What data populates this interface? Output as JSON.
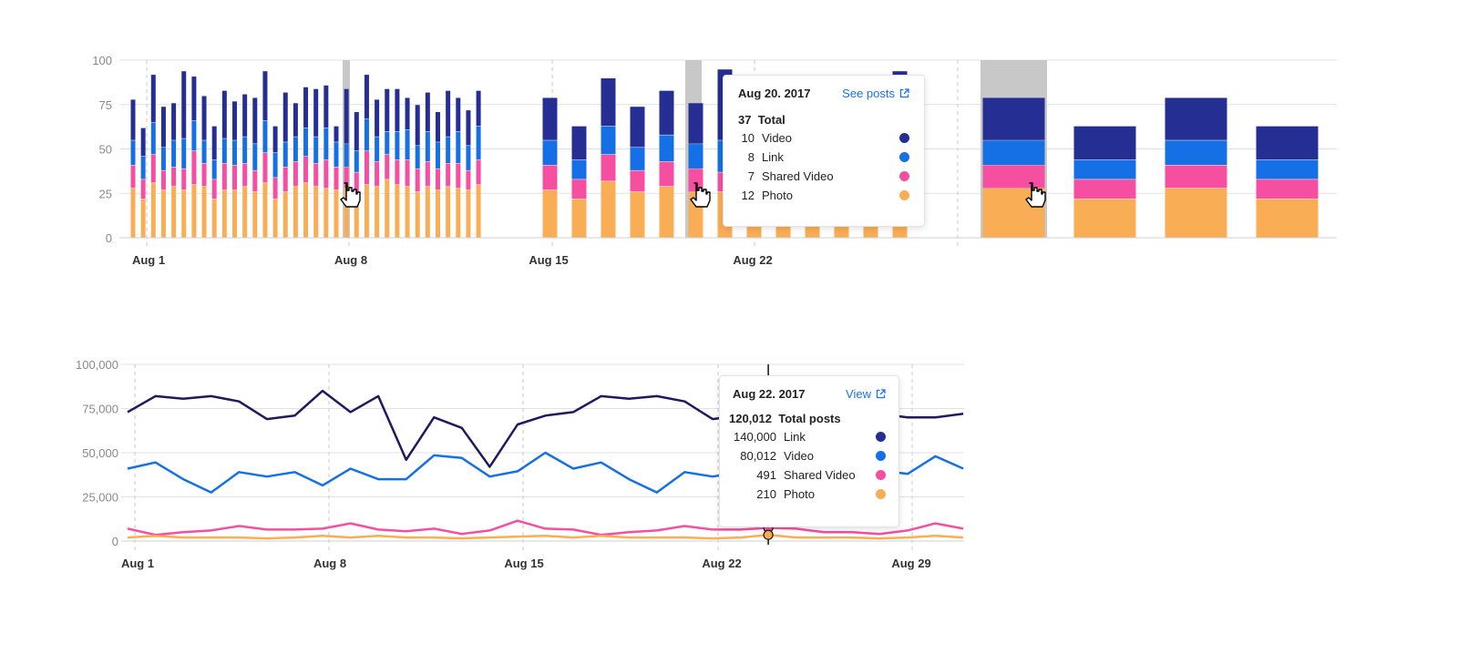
{
  "colors": {
    "video": "#252e92",
    "link": "#1570e6",
    "shared_video": "#f64ea1",
    "photo": "#f9ad55",
    "line_link": "#1e1a5e",
    "line_video": "#1570e6",
    "line_shared": "#f64ea1",
    "line_photo": "#f9ad55",
    "highlight": "#c8c8c8"
  },
  "chart_data": [
    {
      "type": "bar",
      "stacked": true,
      "y_ticks": [
        "100",
        "75",
        "50",
        "25",
        "0"
      ],
      "ylim": [
        0,
        100
      ],
      "x_tick_labels": [
        "Aug 1",
        "Aug 8",
        "Aug 15",
        "Aug 22"
      ],
      "groups": [
        {
          "granularity": "half-day",
          "photo": [
            28,
            22,
            31,
            27,
            29,
            27,
            30,
            29,
            22,
            27,
            27,
            29,
            26,
            31,
            22,
            26,
            29,
            31,
            29,
            28,
            27,
            28,
            26,
            30,
            29,
            33,
            30,
            29,
            26,
            29,
            27,
            29,
            28,
            27,
            30
          ],
          "shared_video": [
            13,
            11,
            16,
            11,
            11,
            12,
            19,
            13,
            11,
            15,
            14,
            13,
            12,
            17,
            12,
            14,
            14,
            15,
            13,
            16,
            13,
            12,
            11,
            19,
            14,
            14,
            14,
            15,
            13,
            14,
            12,
            13,
            14,
            11,
            14
          ],
          "link": [
            14,
            13,
            18,
            13,
            15,
            17,
            17,
            13,
            11,
            14,
            14,
            15,
            15,
            18,
            14,
            14,
            14,
            16,
            15,
            18,
            14,
            13,
            12,
            18,
            14,
            13,
            16,
            17,
            13,
            17,
            15,
            15,
            18,
            14,
            19
          ],
          "video": [
            23,
            16,
            27,
            23,
            21,
            38,
            25,
            25,
            19,
            27,
            22,
            24,
            26,
            28,
            15,
            28,
            19,
            23,
            27,
            24,
            9,
            31,
            22,
            25,
            21,
            24,
            24,
            18,
            23,
            22,
            17,
            26,
            19,
            20,
            20
          ]
        },
        {
          "granularity": "day",
          "photo": [
            27,
            22,
            32,
            26,
            29,
            26,
            26,
            26,
            25,
            26,
            26,
            26,
            26
          ],
          "shared_video": [
            14,
            11,
            15,
            12,
            14,
            13,
            11,
            15,
            12,
            12,
            14,
            14,
            23
          ],
          "link": [
            14,
            11,
            16,
            13,
            15,
            14,
            18,
            17,
            15,
            13,
            18,
            14,
            17
          ],
          "video": [
            24,
            19,
            27,
            23,
            25,
            23,
            40,
            29,
            23,
            23,
            20,
            21,
            28
          ]
        },
        {
          "granularity": "week",
          "photo": [
            28,
            22,
            28,
            22
          ],
          "shared_video": [
            13,
            11,
            13,
            11
          ],
          "link": [
            14,
            11,
            14,
            11
          ],
          "video": [
            24,
            19,
            24,
            19
          ]
        }
      ]
    },
    {
      "type": "line",
      "y_ticks": [
        "100,000",
        "75,000",
        "50,000",
        "25,000",
        "0"
      ],
      "ylim": [
        0,
        100000
      ],
      "x_tick_labels": [
        "Aug 1",
        "Aug 8",
        "Aug 15",
        "Aug 22",
        "Aug 29"
      ],
      "series": [
        {
          "key": "link",
          "values": [
            73000,
            82000,
            80500,
            82000,
            79000,
            69000,
            71000,
            85000,
            73000,
            82000,
            46000,
            70000,
            64000,
            42000,
            66000,
            71000,
            73000,
            82000,
            80500,
            82000,
            79000,
            69000,
            71000,
            84000,
            73000,
            70000,
            71000,
            72000,
            70000,
            70000,
            72000
          ]
        },
        {
          "key": "video",
          "values": [
            41000,
            44500,
            35000,
            27500,
            39000,
            36500,
            39000,
            31500,
            41000,
            35000,
            35000,
            48500,
            47000,
            36500,
            39500,
            50000,
            41000,
            44500,
            35000,
            27500,
            39000,
            36500,
            39000,
            32000,
            41000,
            40000,
            45000,
            40000,
            38000,
            48000,
            41000
          ]
        },
        {
          "key": "shared_video",
          "values": [
            7000,
            3500,
            5000,
            6000,
            8500,
            6500,
            6500,
            7000,
            10000,
            6500,
            5500,
            7000,
            4000,
            6000,
            11500,
            7000,
            6500,
            3500,
            5000,
            6000,
            8500,
            6500,
            6500,
            7500,
            7000,
            5000,
            5000,
            4000,
            6000,
            10000,
            7000
          ]
        },
        {
          "key": "photo",
          "values": [
            2000,
            3000,
            2000,
            2000,
            2000,
            1500,
            2000,
            3000,
            2000,
            3000,
            2000,
            2000,
            1500,
            2000,
            2500,
            3000,
            2000,
            3000,
            2000,
            2000,
            2000,
            1500,
            2000,
            3500,
            2000,
            2000,
            2000,
            1500,
            2000,
            3000,
            2000
          ]
        }
      ]
    }
  ],
  "tooltip_top": {
    "date": "Aug 20. 2017",
    "link_label": "See posts",
    "total_value": "37",
    "total_label": "Total",
    "rows": [
      {
        "value": "10",
        "label": "Video",
        "color": "#252e92"
      },
      {
        "value": "8",
        "label": "Link",
        "color": "#1570e6"
      },
      {
        "value": "7",
        "label": "Shared Video",
        "color": "#f64ea1"
      },
      {
        "value": "12",
        "label": "Photo",
        "color": "#f9ad55"
      }
    ]
  },
  "tooltip_bottom": {
    "date": "Aug 22. 2017",
    "link_label": "View",
    "total_value": "120,012",
    "total_label": "Total posts",
    "rows": [
      {
        "value": "140,000",
        "label": "Link",
        "color": "#252e92"
      },
      {
        "value": "80,012",
        "label": "Video",
        "color": "#1570e6"
      },
      {
        "value": "491",
        "label": "Shared Video",
        "color": "#f64ea1"
      },
      {
        "value": "210",
        "label": "Photo",
        "color": "#f9ad55"
      }
    ]
  }
}
